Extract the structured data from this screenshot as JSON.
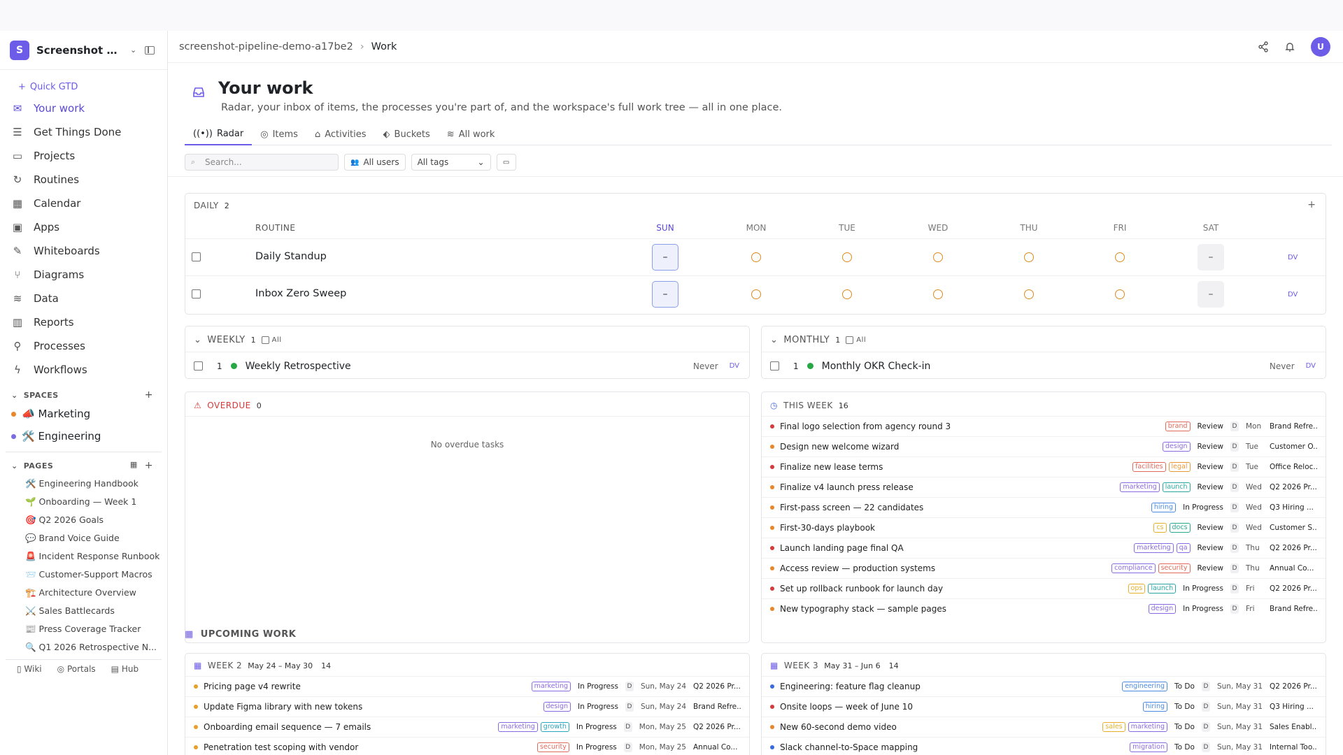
{
  "workspace": {
    "badge": "S",
    "name": "Screenshot Pi..."
  },
  "sidebar": {
    "quick_gtd": "Quick GTD",
    "nav": [
      {
        "label": "Your work",
        "icon": "inbox-icon",
        "active": true
      },
      {
        "label": "Get Things Done",
        "icon": "checklist-icon"
      },
      {
        "label": "Projects",
        "icon": "folder-icon"
      },
      {
        "label": "Routines",
        "icon": "refresh-icon"
      },
      {
        "label": "Calendar",
        "icon": "calendar-icon"
      },
      {
        "label": "Apps",
        "icon": "app-window-icon"
      },
      {
        "label": "Whiteboards",
        "icon": "pencil-icon"
      },
      {
        "label": "Diagrams",
        "icon": "diagram-icon"
      },
      {
        "label": "Data",
        "icon": "database-icon"
      },
      {
        "label": "Reports",
        "icon": "bar-chart-icon"
      },
      {
        "label": "Processes",
        "icon": "process-icon"
      },
      {
        "label": "Workflows",
        "icon": "lightning-icon"
      }
    ],
    "spaces_title": "SPACES",
    "spaces": [
      {
        "label": "📣 Marketing",
        "color": "#e8862a"
      },
      {
        "label": "🛠️ Engineering",
        "color": "#7b6ce0"
      }
    ],
    "pages_title": "PAGES",
    "pages": [
      "🛠️ Engineering Handbook",
      "🌱 Onboarding — Week 1",
      "🎯 Q2 2026 Goals",
      "💬 Brand Voice Guide",
      "🚨 Incident Response Runbook",
      "📨 Customer-Support Macros",
      "🏗️ Architecture Overview",
      "⚔️ Sales Battlecards",
      "📰 Press Coverage Tracker",
      "🔍 Q1 2026 Retrospective N..."
    ],
    "footer": {
      "wiki": "Wiki",
      "portals": "Portals",
      "hub": "Hub"
    }
  },
  "header": {
    "crumb": "screenshot-pipeline-demo-a17be2",
    "current": "Work",
    "avatar": "U"
  },
  "page": {
    "title": "Your work",
    "subtitle": "Radar, your inbox of items, the processes you're part of, and the workspace's full work tree — all in one place."
  },
  "tabs": [
    "Radar",
    "Items",
    "Activities",
    "Buckets",
    "All work"
  ],
  "filters": {
    "search_placeholder": "Search...",
    "users": "All users",
    "tags": "All tags"
  },
  "daily": {
    "title": "DAILY",
    "count": "2",
    "routine_header": "ROUTINE",
    "days": [
      "SUN",
      "MON",
      "TUE",
      "WED",
      "THU",
      "FRI",
      "SAT"
    ],
    "routines": [
      {
        "name": "Daily Standup",
        "today": "–",
        "off": "–",
        "owner": "DV"
      },
      {
        "name": "Inbox Zero Sweep",
        "today": "–",
        "off": "–",
        "owner": "DV"
      }
    ]
  },
  "weekly": {
    "title": "WEEKLY",
    "count": "1",
    "all": "All",
    "item": {
      "num": "1",
      "name": "Weekly Retrospective",
      "last": "Never",
      "owner": "DV"
    }
  },
  "monthly": {
    "title": "MONTHLY",
    "count": "1",
    "all": "All",
    "item": {
      "num": "1",
      "name": "Monthly OKR Check-in",
      "last": "Never",
      "owner": "DV"
    }
  },
  "overdue": {
    "title": "OVERDUE",
    "count": "0",
    "empty": "No overdue tasks"
  },
  "this_week": {
    "title": "THIS WEEK",
    "count": "16",
    "items": [
      {
        "title": "Final logo selection from agency round 3",
        "dot": "#d63a3a",
        "tags": [
          {
            "t": "brand",
            "c": "#e06a5a"
          }
        ],
        "status": "Review",
        "day": "Mon",
        "proj": "Brand Refre..."
      },
      {
        "title": "Design new welcome wizard",
        "dot": "#e8862a",
        "tags": [
          {
            "t": "design",
            "c": "#8a6ae0"
          }
        ],
        "status": "Review",
        "day": "Tue",
        "proj": "Customer O..."
      },
      {
        "title": "Finalize new lease terms",
        "dot": "#d63a3a",
        "tags": [
          {
            "t": "facilities",
            "c": "#e06a5a"
          },
          {
            "t": "legal",
            "c": "#e89a3a"
          }
        ],
        "status": "Review",
        "day": "Tue",
        "proj": "Office Reloc..."
      },
      {
        "title": "Finalize v4 launch press release",
        "dot": "#e8862a",
        "tags": [
          {
            "t": "marketing",
            "c": "#8a6ae0"
          },
          {
            "t": "launch",
            "c": "#2aa8a0"
          }
        ],
        "status": "Review",
        "day": "Wed",
        "proj": "Q2 2026 Pr..."
      },
      {
        "title": "First-pass screen — 22 candidates",
        "dot": "#e8862a",
        "tags": [
          {
            "t": "hiring",
            "c": "#4a8ae0"
          }
        ],
        "status": "In Progress",
        "day": "Wed",
        "proj": "Q3 Hiring ..."
      },
      {
        "title": "First-30-days playbook",
        "dot": "#e8862a",
        "tags": [
          {
            "t": "cs",
            "c": "#e8b02a"
          },
          {
            "t": "docs",
            "c": "#2aa890"
          }
        ],
        "status": "Review",
        "day": "Wed",
        "proj": "Customer S..."
      },
      {
        "title": "Launch landing page final QA",
        "dot": "#d63a3a",
        "tags": [
          {
            "t": "marketing",
            "c": "#8a6ae0"
          },
          {
            "t": "qa",
            "c": "#8a6ae0"
          }
        ],
        "status": "Review",
        "day": "Thu",
        "proj": "Q2 2026 Pr..."
      },
      {
        "title": "Access review — production systems",
        "dot": "#e8862a",
        "tags": [
          {
            "t": "compliance",
            "c": "#8a6ae0"
          },
          {
            "t": "security",
            "c": "#e06a5a"
          }
        ],
        "status": "Review",
        "day": "Thu",
        "proj": "Annual Co..."
      },
      {
        "title": "Set up rollback runbook for launch day",
        "dot": "#d63a3a",
        "tags": [
          {
            "t": "ops",
            "c": "#e8b02a"
          },
          {
            "t": "launch",
            "c": "#2aa8a0"
          }
        ],
        "status": "In Progress",
        "day": "Fri",
        "proj": "Q2 2026 Pr..."
      },
      {
        "title": "New typography stack — sample pages",
        "dot": "#e8862a",
        "tags": [
          {
            "t": "design",
            "c": "#8a6ae0"
          }
        ],
        "status": "In Progress",
        "day": "Fri",
        "proj": "Brand Refre..."
      }
    ]
  },
  "upcoming": {
    "title": "UPCOMING WORK",
    "week2": {
      "title": "WEEK 2",
      "range": "May 24 – May 30",
      "count": "14",
      "items": [
        {
          "title": "Pricing page v4 rewrite",
          "dot": "#e8a02a",
          "tags": [
            {
              "t": "marketing",
              "c": "#8a6ae0"
            }
          ],
          "status": "In Progress",
          "date": "Sun, May 24",
          "proj": "Q2 2026 Pr..."
        },
        {
          "title": "Update Figma library with new tokens",
          "dot": "#e8a02a",
          "tags": [
            {
              "t": "design",
              "c": "#8a6ae0"
            }
          ],
          "status": "In Progress",
          "date": "Sun, May 24",
          "proj": "Brand Refre..."
        },
        {
          "title": "Onboarding email sequence — 7 emails",
          "dot": "#e8a02a",
          "tags": [
            {
              "t": "marketing",
              "c": "#8a6ae0"
            },
            {
              "t": "growth",
              "c": "#2aa8c0"
            }
          ],
          "status": "In Progress",
          "date": "Mon, May 25",
          "proj": "Q2 2026 Pr..."
        },
        {
          "title": "Penetration test scoping with vendor",
          "dot": "#e8a02a",
          "tags": [
            {
              "t": "security",
              "c": "#e06a5a"
            }
          ],
          "status": "In Progress",
          "date": "Mon, May 25",
          "proj": "Annual Co..."
        }
      ]
    },
    "week3": {
      "title": "WEEK 3",
      "range": "May 31 – Jun 6",
      "count": "14",
      "items": [
        {
          "title": "Engineering: feature flag cleanup",
          "dot": "#3a6ae0",
          "tags": [
            {
              "t": "engineering",
              "c": "#4a8ae0"
            }
          ],
          "status": "To Do",
          "date": "Sun, May 31",
          "proj": "Q2 2026 Pr..."
        },
        {
          "title": "Onsite loops — week of June 10",
          "dot": "#d63a3a",
          "tags": [
            {
              "t": "hiring",
              "c": "#4a8ae0"
            }
          ],
          "status": "To Do",
          "date": "Sun, May 31",
          "proj": "Q3 Hiring ..."
        },
        {
          "title": "New 60-second demo video",
          "dot": "#e8862a",
          "tags": [
            {
              "t": "sales",
              "c": "#e8b02a"
            },
            {
              "t": "marketing",
              "c": "#8a6ae0"
            }
          ],
          "status": "To Do",
          "date": "Sun, May 31",
          "proj": "Sales Enabl..."
        },
        {
          "title": "Slack channel-to-Space mapping",
          "dot": "#3a6ae0",
          "tags": [
            {
              "t": "migration",
              "c": "#8a6ae0"
            }
          ],
          "status": "To Do",
          "date": "Sun, May 31",
          "proj": "Internal Too..."
        }
      ]
    }
  }
}
